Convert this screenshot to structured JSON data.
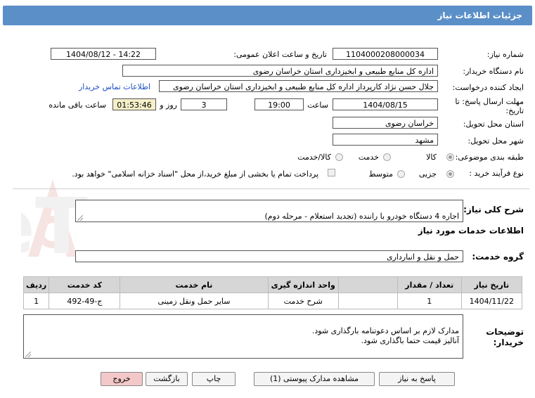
{
  "header": {
    "title": "جزئیات اطلاعات نیاز"
  },
  "fields": {
    "need_number_label": "شماره نیاز:",
    "need_number": "1104000208000034",
    "announce_label": "تاریخ و ساعت اعلان عمومی:",
    "announce_value": "1404/08/12 - 14:22",
    "buyer_org_label": "نام دستگاه خریدار:",
    "buyer_org": "اداره کل منابع طبیعی و ابخیزداری استان خراسان رضوی",
    "creator_label": "ایجاد کننده درخواست:",
    "creator": "جلال حسن نژاد کارپرداز اداره کل منابع طبیعی و ابخیزداری استان خراسان رضوی",
    "contact_link": "اطلاعات تماس خریدار",
    "deadline_label_1": "مهلت ارسال پاسخ: تا",
    "deadline_label_2": "تاریخ:",
    "deadline_date": "1404/08/15",
    "time_label": "ساعت",
    "deadline_time": "19:00",
    "days_value": "3",
    "days_label": "روز و",
    "remaining_time": "01:53:46",
    "remaining_label": "ساعت باقی مانده",
    "province_label": "استان محل تحویل:",
    "province": "خراسان رضوی",
    "city_label": "شهر محل تحویل:",
    "city": "مشهد",
    "category_label": "طبقه بندی موضوعی:",
    "cat_goods": "کالا",
    "cat_service": "خدمت",
    "cat_goods_service": "کالا/خدمت",
    "process_label": "نوع فرآیند خرید :",
    "proc_minor": "جزیی",
    "proc_medium": "متوسط",
    "payment_note": "پرداخت تمام یا بخشی از مبلغ خرید،از محل \"اسناد خزانه اسلامی\" خواهد بود."
  },
  "selection": {
    "category": "کالا",
    "process": "جزیی"
  },
  "summary": {
    "label": "شرح کلی نیاز:",
    "text": "اجاره 4 دستگاه خودرو با راننده (تجدید استعلام - مرحله دوم)"
  },
  "services": {
    "section_title": "اطلاعات خدمات مورد نیاز",
    "group_label": "گروه خدمت:",
    "group_value": "حمل و نقل و انبارداری",
    "columns": [
      "ردیف",
      "کد خدمت",
      "نام خدمت",
      "واحد اندازه گیری",
      "تعداد / مقدار",
      "تاریخ نیاز"
    ],
    "rows": [
      [
        "1",
        "ج-49-492",
        "سایر حمل ونقل زمینی",
        "شرح خدمت",
        "1",
        "1404/11/22"
      ]
    ]
  },
  "buyer_notes": {
    "label_1": "توضیحات",
    "label_2": "خریدار:",
    "text": "مدارک لازم  بر اساس دعوتنامه بارگذاری شود.\nآنالیز قیمت حتما باگذاری شود."
  },
  "buttons": {
    "reply": "پاسخ به نیاز",
    "attachments": "مشاهده مدارک پیوستی (1)",
    "print": "چاپ",
    "back": "بازگشت",
    "exit": "خروج"
  },
  "watermark": {
    "text": "AriaTender.neT"
  },
  "colors": {
    "header": "#5a8fc8",
    "link": "#1a4fc4",
    "timer_bg": "#f5f0c8",
    "exit_btn": "#f4c8c8"
  }
}
